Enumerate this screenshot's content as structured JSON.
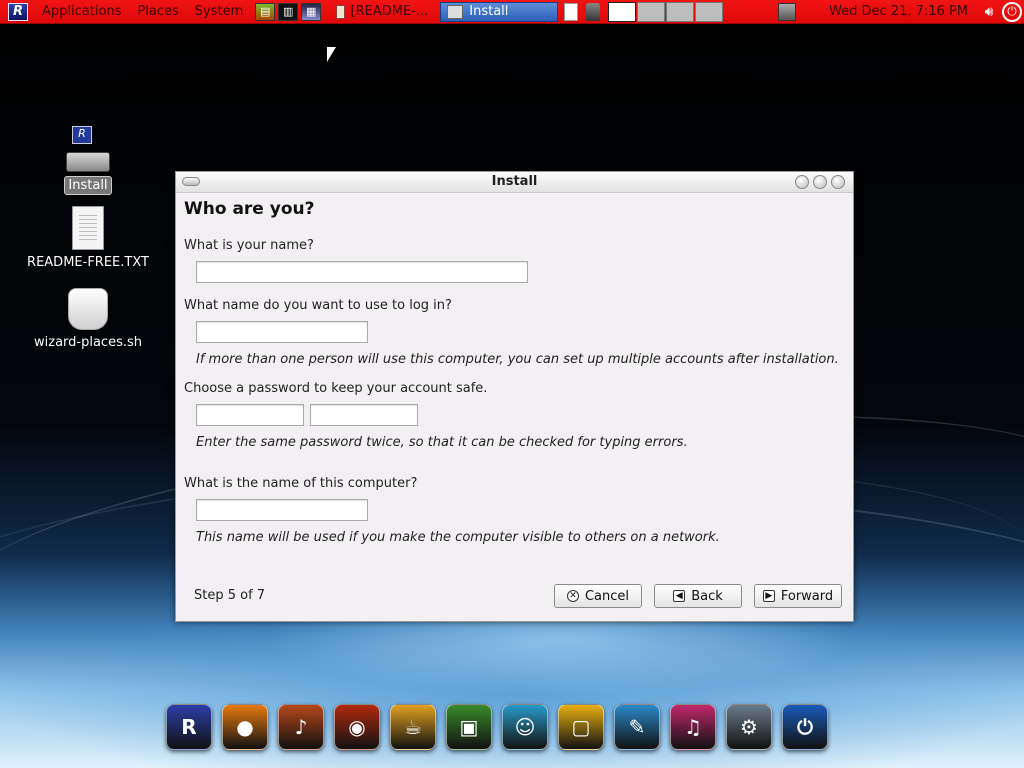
{
  "top_panel": {
    "logo_glyph": "R",
    "menus": [
      "Applications",
      "Places",
      "System"
    ],
    "launcher_icons": [
      "audio-mixer-icon",
      "piano-keyboard-icon",
      "media-player-icon"
    ],
    "tasks": [
      {
        "label": "[README-...",
        "icon": "text-editor-icon"
      },
      {
        "label": "Install",
        "icon": "installer-icon"
      }
    ],
    "workspaces": 4,
    "clock": "Wed Dec 21,  7:16 PM"
  },
  "desktop_icons": [
    {
      "label": "Install",
      "icon": "installer-disk-icon"
    },
    {
      "label": "README-FREE.TXT",
      "icon": "text-document-icon"
    },
    {
      "label": "wizard-places.sh",
      "icon": "shell-script-icon"
    }
  ],
  "window": {
    "title": "Install",
    "heading": "Who are you?",
    "name_label": "What is your name?",
    "name_value": "",
    "login_label": "What name do you want to use to log in?",
    "login_value": "",
    "login_hint": "If more than one person will use this computer, you can set up multiple accounts after installation.",
    "password_label": "Choose a password to keep your account safe.",
    "password_value": "",
    "password_confirm_value": "",
    "password_hint": "Enter the same password twice, so that it can be checked for typing errors.",
    "computer_label": "What is the name of this computer?",
    "computer_value": "",
    "computer_hint": "This name will be used if you make the computer visible to others on a network.",
    "step": "Step 5 of 7",
    "buttons": {
      "cancel": "Cancel",
      "back": "Back",
      "forward": "Forward"
    }
  },
  "dock": [
    {
      "icon": "rebellin-logo-icon",
      "color": "#2a3fa8",
      "glyph": "R"
    },
    {
      "icon": "firefox-icon",
      "color": "#e67a10",
      "glyph": "●"
    },
    {
      "icon": "guitar-icon",
      "color": "#b5471a",
      "glyph": "♪"
    },
    {
      "icon": "burn-disc-icon",
      "color": "#b02a10",
      "glyph": "◉"
    },
    {
      "icon": "coffee-cup-icon",
      "color": "#e0a020",
      "glyph": "☕"
    },
    {
      "icon": "photo-editor-icon",
      "color": "#3a8a2a",
      "glyph": "▣"
    },
    {
      "icon": "messenger-icon",
      "color": "#2a9ac8",
      "glyph": "☺"
    },
    {
      "icon": "office-icon",
      "color": "#e8b010",
      "glyph": "▢"
    },
    {
      "icon": "drawing-icon",
      "color": "#2a88c8",
      "glyph": "✎"
    },
    {
      "icon": "music-player-icon",
      "color": "#c0286a",
      "glyph": "♫"
    },
    {
      "icon": "system-settings-icon",
      "color": "#6a7a8a",
      "glyph": "⚙"
    },
    {
      "icon": "shutdown-icon",
      "color": "#1a5ab8",
      "glyph": "⏻"
    }
  ]
}
